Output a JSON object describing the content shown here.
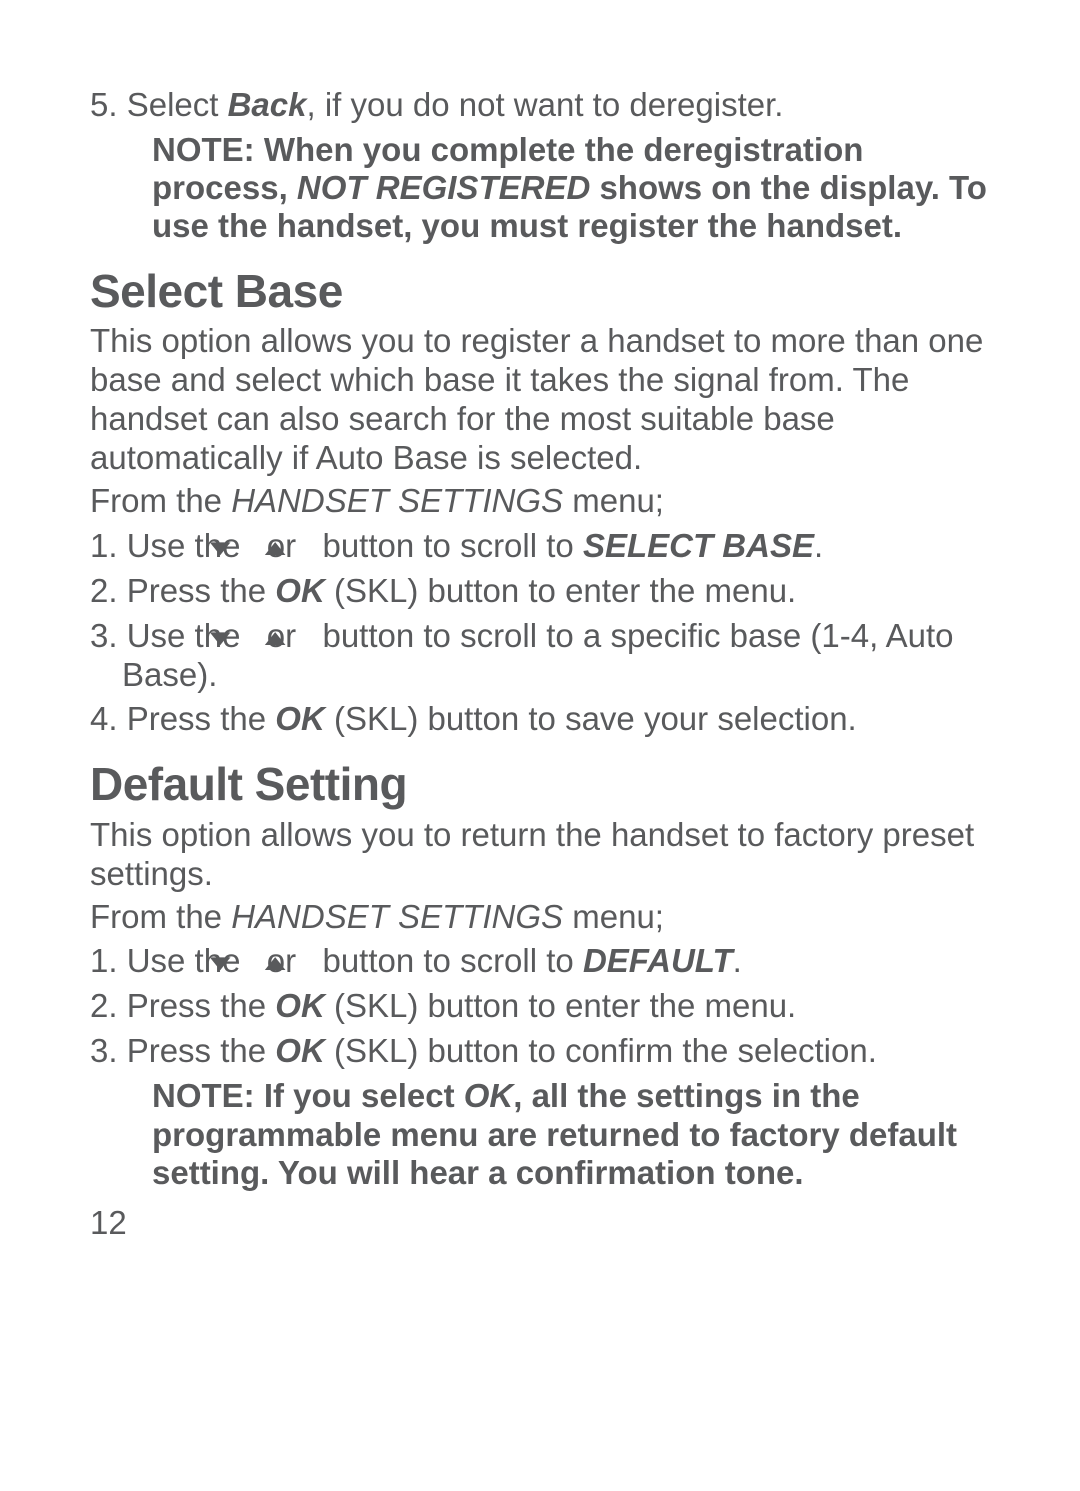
{
  "step5": {
    "num": "5.",
    "t1": "Select ",
    "back": "Back",
    "t2": ", if you do not want to deregister."
  },
  "note1": {
    "t1": "NOTE: When you complete the deregistration process, ",
    "nr": "NOT REGISTERED",
    "t2": " shows on the display. To use the handset, you must register the handset."
  },
  "h_select": "Select Base",
  "select_desc": {
    "t1": "This option allows you to register a handset to more than one base and select which base it takes the signal from. The handset can also search for the most suitable base automatically if Auto Base is selected.",
    "t2a": "From the ",
    "t2b": "HANDSET SETTINGS",
    "t2c": " menu;"
  },
  "sb1": {
    "num": "1.",
    "a": "Use the ",
    "or": " or ",
    "b": " button to scroll to ",
    "target": "SELECT BASE",
    "end": "."
  },
  "sb2": {
    "num": "2.",
    "a": "Press the ",
    "ok": "OK",
    "b": " (SKL) button to enter the menu."
  },
  "sb3": {
    "num": "3.",
    "a": "Use the ",
    "or": " or ",
    "b": " button to scroll to a specific base (1-4, Auto Base)."
  },
  "sb4": {
    "num": "4.",
    "a": "Press the ",
    "ok": "OK",
    "b": " (SKL) button to save your selection."
  },
  "h_default": "Default Setting",
  "default_desc": {
    "t1": "This option allows you to return the handset to factory preset settings.",
    "t2a": "From the ",
    "t2b": "HANDSET SETTINGS",
    "t2c": " menu;"
  },
  "ds1": {
    "num": "1.",
    "a": "Use the ",
    "or": " or ",
    "b": " button to scroll to ",
    "target": "DEFAULT",
    "end": "."
  },
  "ds2": {
    "num": "2.",
    "a": "Press the ",
    "ok": "OK",
    "b": " (SKL) button to enter the menu."
  },
  "ds3": {
    "num": "3.",
    "a": "Press the ",
    "ok": "OK",
    "b": " (SKL) button to confirm the selection."
  },
  "note2": {
    "t1": "NOTE: If you select ",
    "ok": "OK",
    "t2": ", all the settings in the programmable menu are returned to factory default setting. You will hear a confirmation tone."
  },
  "page_number": "12",
  "glyphs": {
    "down": "▼",
    "up": "▲"
  }
}
